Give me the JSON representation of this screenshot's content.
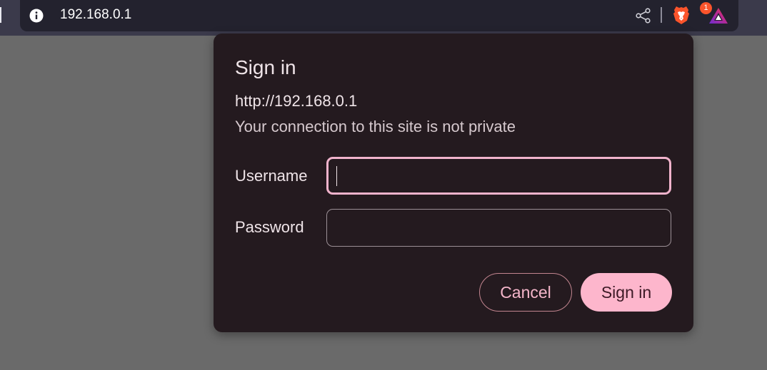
{
  "browser": {
    "address_bar": {
      "url": "192.168.0.1"
    },
    "toolbar": {
      "icons": [
        "info-icon",
        "share-icon",
        "brave-shields-icon",
        "brave-rewards-icon"
      ],
      "rewards_badge": "1"
    }
  },
  "dialog": {
    "title": "Sign in",
    "origin": "http://192.168.0.1",
    "warning": "Your connection to this site is not private",
    "username": {
      "label": "Username",
      "value": ""
    },
    "password": {
      "label": "Password",
      "value": ""
    },
    "cancel_label": "Cancel",
    "signin_label": "Sign in"
  },
  "colors": {
    "page_bg": "#6a6a6a",
    "toolbar_bg": "#3b3a4b",
    "omnibox_bg": "#23222e",
    "dialog_bg": "#241a1f",
    "accent": "#fdb6cc",
    "badge": "#fb542b"
  }
}
